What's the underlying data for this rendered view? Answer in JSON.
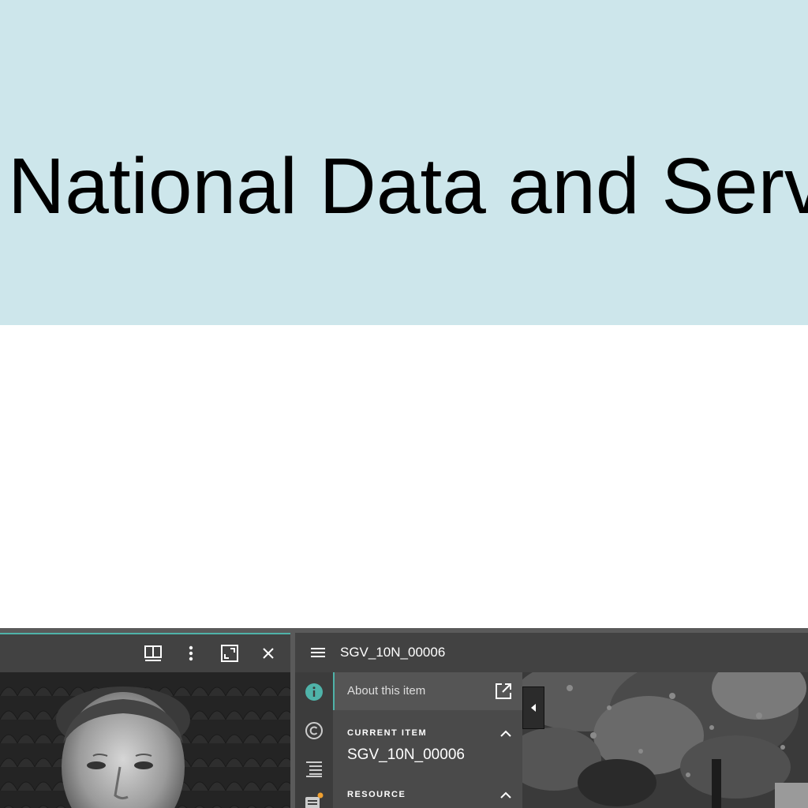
{
  "banner": {
    "title": "National Data and Serv"
  },
  "viewer": {
    "left_window": {
      "toolbar_icons": [
        "split-view-icon",
        "more-vert-icon",
        "fullscreen-icon",
        "close-icon"
      ]
    },
    "right_window": {
      "title": "SGV_10N_00006",
      "rail_icons": [
        "info-icon",
        "copyright-icon",
        "toc-icon",
        "annotations-icon"
      ],
      "panel": {
        "about_label": "About this item",
        "current_item_heading": "CURRENT ITEM",
        "current_item_value": "SGV_10N_00006",
        "resource_heading": "RESOURCE"
      }
    },
    "colors": {
      "accent": "#4fb3a9",
      "banner_bg": "#cde6eb",
      "badge": "#f0a030"
    }
  }
}
